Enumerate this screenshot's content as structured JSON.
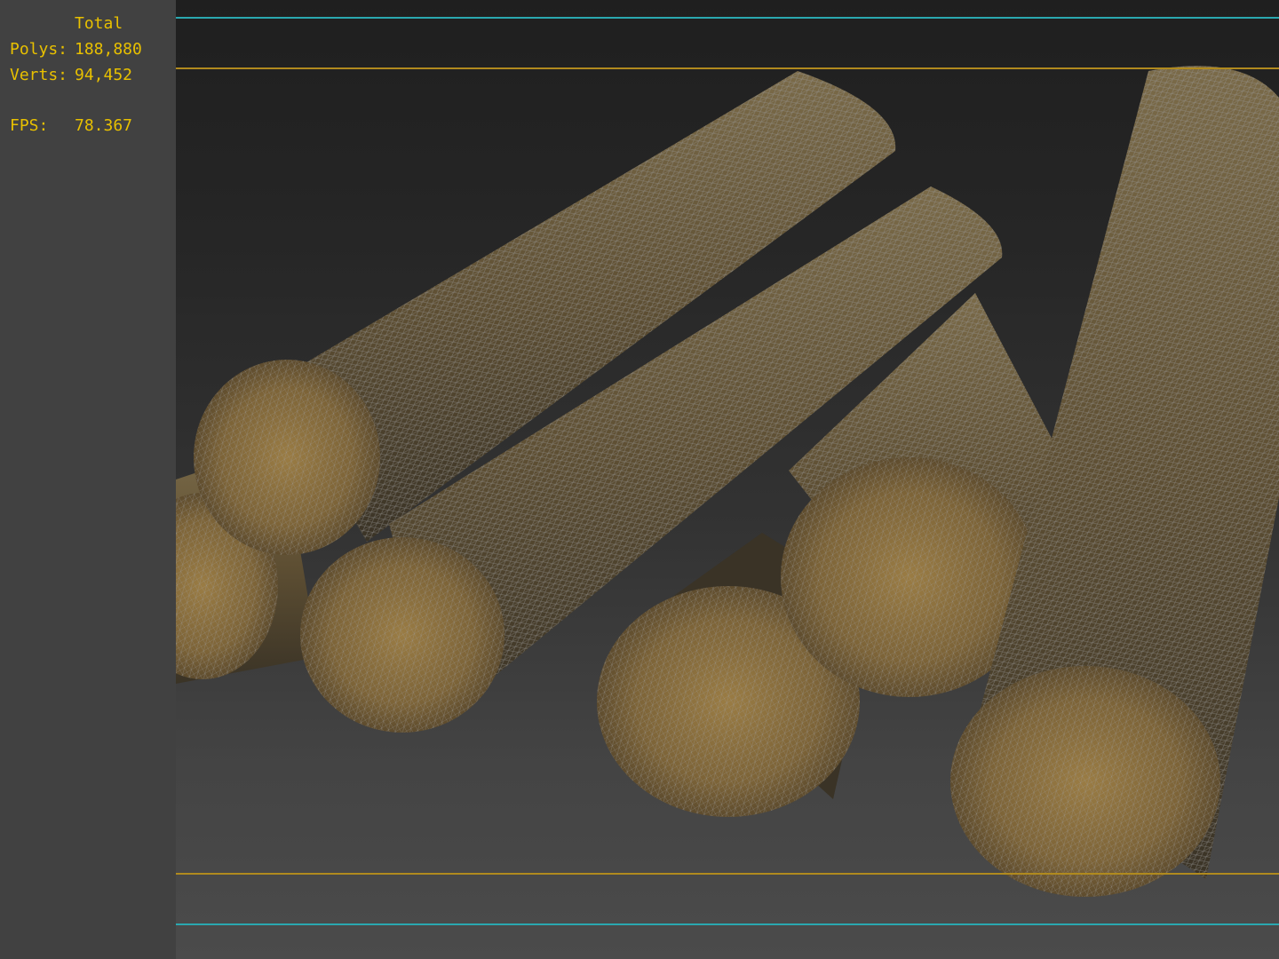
{
  "stats": {
    "header": "Total",
    "polys_label": "Polys:",
    "polys_value": "188,880",
    "verts_label": "Verts:",
    "verts_value": "94,452",
    "fps_label": "FPS:",
    "fps_value": "78.367"
  },
  "colors": {
    "stats_text": "#e8c000",
    "safe_frame_outer": "#2aa8b0",
    "safe_frame_inner": "#b08a1e",
    "log_bark": "#6b5a3a",
    "log_end": "#8a6e3a",
    "wire": "#8c8c8c"
  },
  "viewport": {
    "render_mode": "shaded-wireframe",
    "objects": [
      "log",
      "log",
      "log",
      "log",
      "log",
      "log"
    ]
  }
}
